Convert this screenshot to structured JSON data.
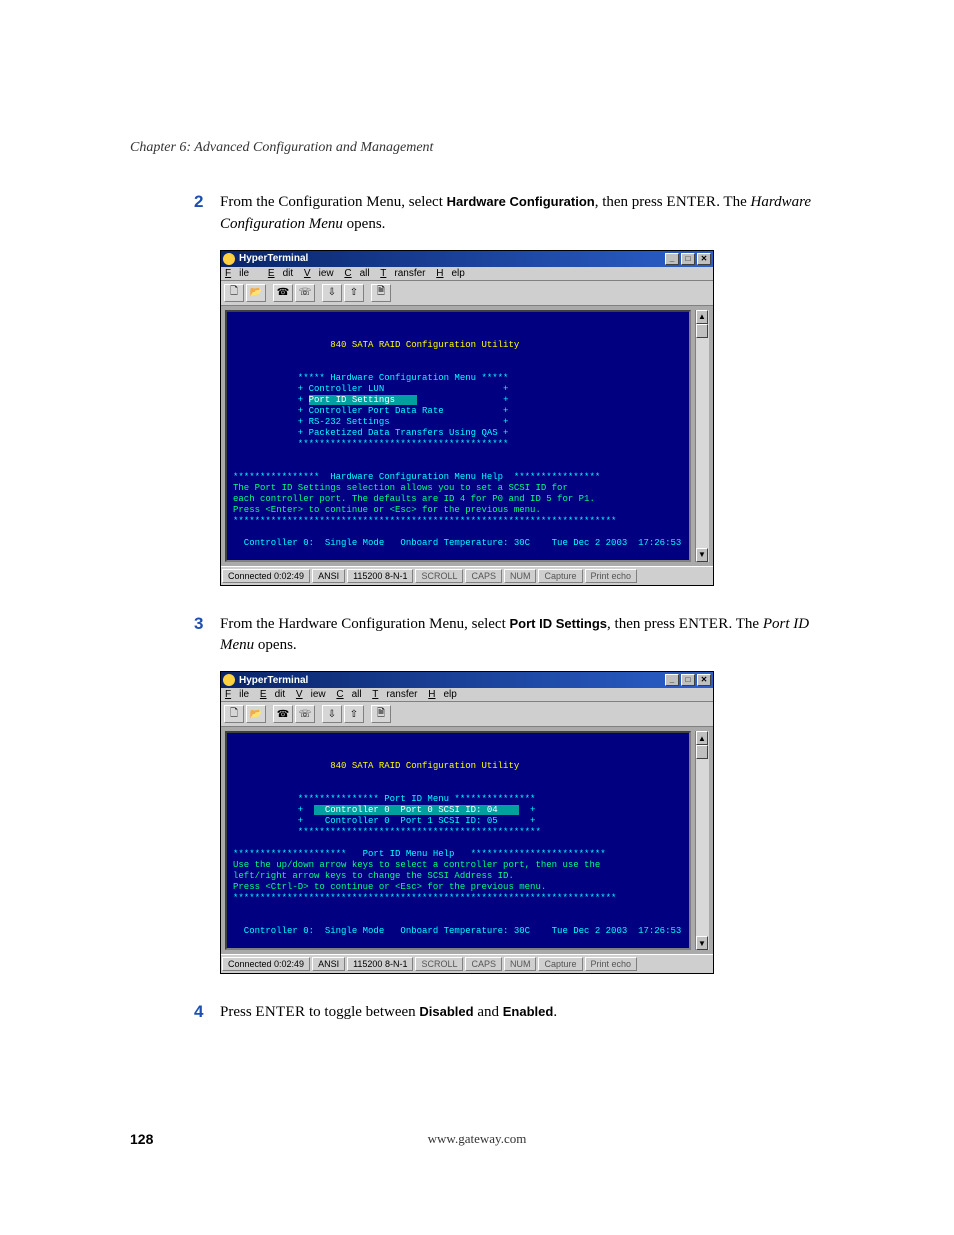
{
  "chapter_header": "Chapter 6: Advanced Configuration and Management",
  "steps": {
    "s2": {
      "num": "2",
      "pre": "From the Configuration Menu, select ",
      "bold": "Hardware Configuration",
      "mid": ", then press ",
      "enter": "ENTER",
      "post1": ". The ",
      "italic": "Hardware Configuration Menu",
      "post2": " opens."
    },
    "s3": {
      "num": "3",
      "pre": "From the Hardware Configuration Menu, select ",
      "bold": "Port ID Settings",
      "mid": ", then press ",
      "enter": "ENTER",
      "post1": ". The ",
      "italic": "Port ID Menu",
      "post2": " opens."
    },
    "s4": {
      "num": "4",
      "pre": "Press ",
      "enter": "ENTER",
      "mid": " to toggle between ",
      "bold1": "Disabled",
      "and": " and ",
      "bold2": "Enabled",
      "post": "."
    }
  },
  "ht": {
    "title": "HyperTerminal",
    "menu": {
      "file": "File",
      "edit": "Edit",
      "view": "View",
      "call": "Call",
      "transfer": "Transfer",
      "help": "Help"
    },
    "buttons": {
      "min": "_",
      "max": "□",
      "close": "✕",
      "up": "▲",
      "down": "▼"
    },
    "statusbar": {
      "connected": "Connected 0:02:49",
      "emul": "ANSI",
      "baud": "115200 8-N-1",
      "scroll": "SCROLL",
      "caps": "CAPS",
      "num": "NUM",
      "capture": "Capture",
      "print": "Print echo"
    }
  },
  "term1": {
    "title_line": "                  840 SATA RAID Configuration Utility",
    "menu_title": "            ***** Hardware Configuration Menu *****",
    "l1": "            + Controller LUN                      +",
    "l2_pre": "            + ",
    "l2_sel": "Port ID Settings    ",
    "l2_post": "                +",
    "l3": "            + Controller Port Data Rate           +",
    "l4": "            + RS-232 Settings                     +",
    "l5": "            + Packetized Data Transfers Using QAS +",
    "l6": "            ***************************************",
    "help_title": "****************  Hardware Configuration Menu Help  ****************",
    "h1": "The Port ID Settings selection allows you to set a SCSI ID for",
    "h2": "each controller port. The defaults are ID 4 for P0 and ID 5 for P1.",
    "h3": "Press <Enter> to continue or <Esc> for the previous menu.",
    "h4": "***********************************************************************",
    "status": "  Controller 0:  Single Mode   Onboard Temperature: 30C    Tue Dec 2 2003  17:26:53  "
  },
  "term2": {
    "title_line": "                  840 SATA RAID Configuration Utility",
    "menu_title": "            *************** Port ID Menu ***************",
    "l1_pre": "            +  ",
    "l1_sel": "  Controller 0  Port 0 SCSI ID: 04    ",
    "l1_post": "  +",
    "l2_pre": "            +  ",
    "l2_txt": "  Controller 0  Port 1 SCSI ID: 05    ",
    "l2_post": "  +",
    "l3": "            *********************************************",
    "help_title": "*********************   Port ID Menu Help   ************************* ",
    "h1": "Use the up/down arrow keys to select a controller port, then use the",
    "h2": "left/right arrow keys to change the SCSI Address ID.",
    "h3": "Press <Ctrl-D> to continue or <Esc> for the previous menu.",
    "h4": "***********************************************************************",
    "status": "  Controller 0:  Single Mode   Onboard Temperature: 30C    Tue Dec 2 2003  17:26:53  "
  },
  "footer": {
    "page": "128",
    "url": "www.gateway.com"
  }
}
